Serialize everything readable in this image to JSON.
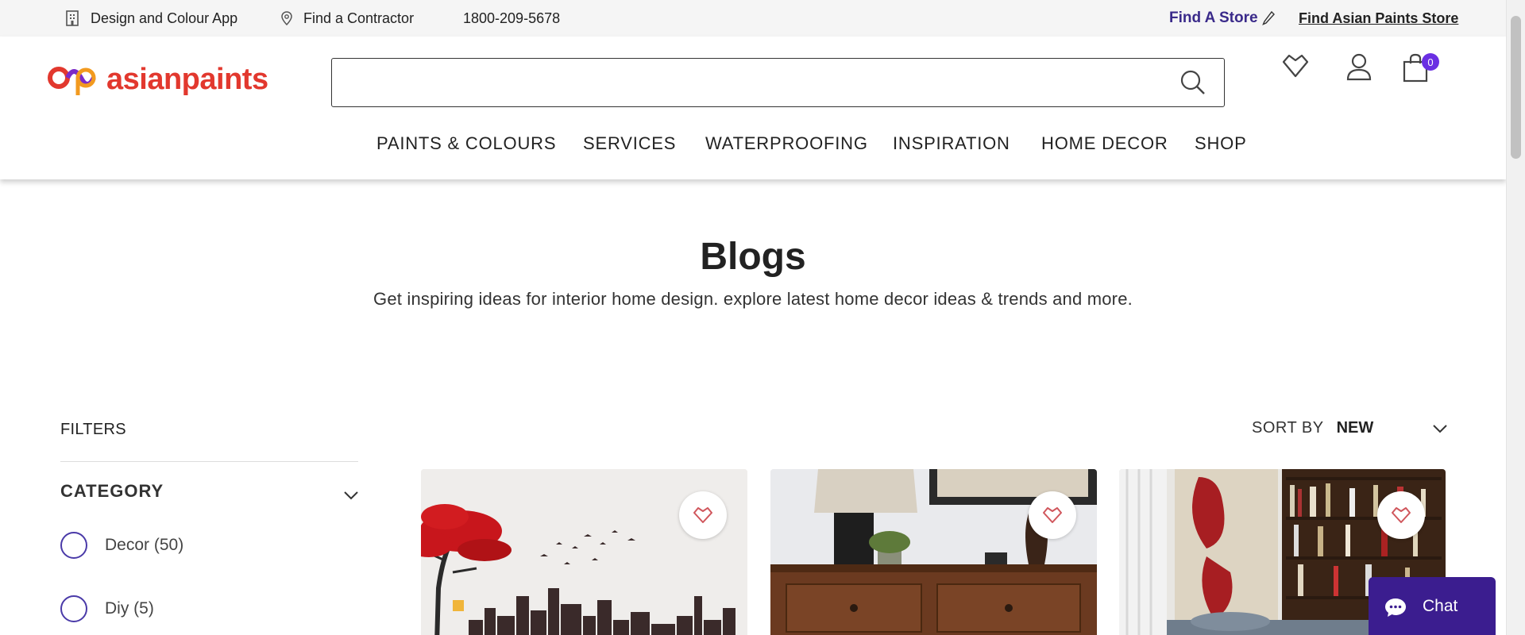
{
  "topbar": {
    "app_label": "Design and Colour App",
    "contractor_label": "Find a Contractor",
    "phone": "1800-209-5678",
    "find_store_label": "Find A Store",
    "find_ap_store_label": "Find Asian Paints Store"
  },
  "header": {
    "logo_text": "asianpaints",
    "search": {
      "value": "",
      "placeholder": ""
    },
    "cart_count": "0"
  },
  "nav": {
    "items": [
      {
        "label": "PAINTS & COLOURS"
      },
      {
        "label": "SERVICES"
      },
      {
        "label": "WATERPROOFING"
      },
      {
        "label": "INSPIRATION"
      },
      {
        "label": "HOME DECOR"
      },
      {
        "label": "SHOP"
      }
    ]
  },
  "hero": {
    "title": "Blogs",
    "subtitle": "Get inspiring ideas for interior home design. explore latest home decor ideas & trends and more."
  },
  "filters": {
    "title": "FILTERS",
    "category": {
      "title": "CATEGORY",
      "options": [
        {
          "label": "Decor (50)"
        },
        {
          "label": "Diy (5)"
        }
      ]
    }
  },
  "sort": {
    "label": "SORT BY",
    "value": "NEW"
  },
  "chat": {
    "label": "Chat"
  },
  "colors": {
    "brand_red": "#e2382e",
    "brand_purple": "#6a2fe3",
    "chat_bg": "#3b1d8f",
    "radio_border": "#4a3aa8"
  }
}
